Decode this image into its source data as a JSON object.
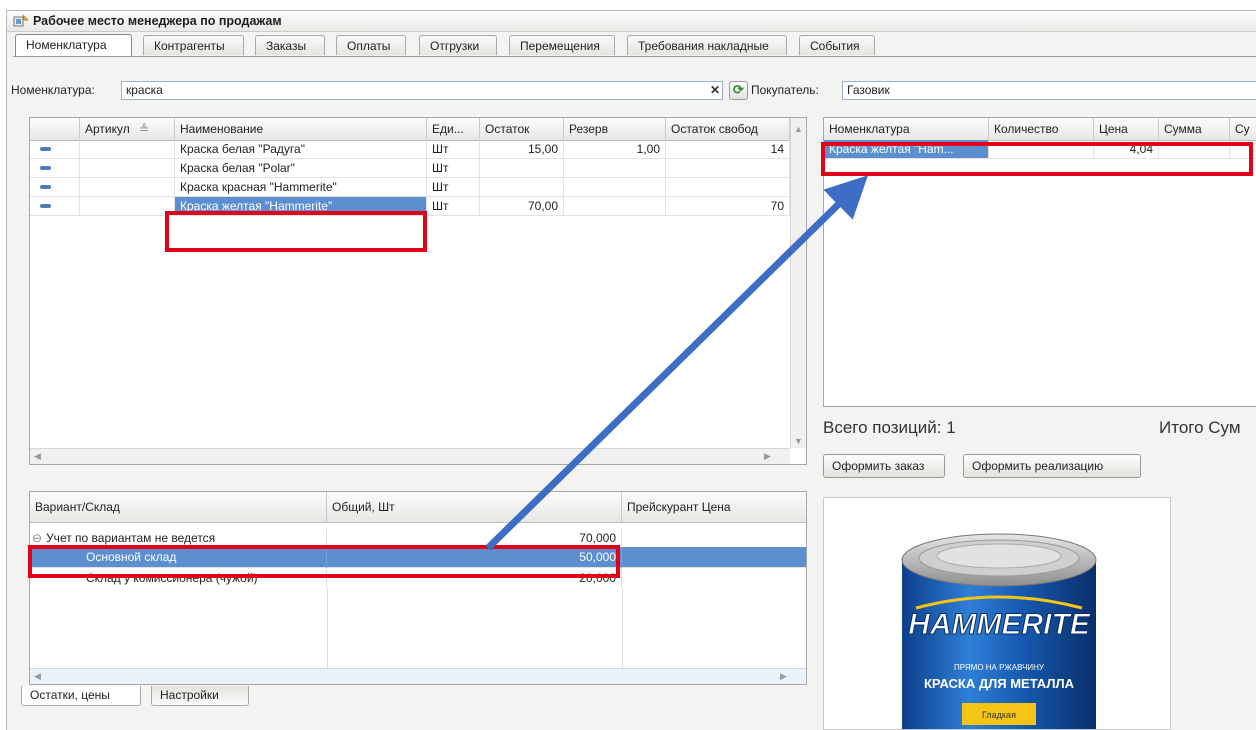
{
  "window": {
    "title": "Рабочее место менеджера по продажам"
  },
  "tabs": [
    "Номенклатура",
    "Контрагенты",
    "Заказы",
    "Оплаты",
    "Отгрузки",
    "Перемещения",
    "Требования накладные",
    "События"
  ],
  "filter": {
    "nomenclature_label": "Номенклатура:",
    "nomenclature_value": "краска",
    "clear_glyph": "✕",
    "refresh_glyph": "⟳",
    "buyer_label": "Покупатель:",
    "buyer_value": "Газовик"
  },
  "products": {
    "columns": [
      "Артикул",
      "Наименование",
      "Еди...",
      "Остаток",
      "Резерв",
      "Остаток свобод"
    ],
    "sort_glyph": "≜",
    "rows": [
      {
        "article": "",
        "name": "Краска белая \"Радуга\"",
        "unit": "Шт",
        "stock": "15,00",
        "reserve": "1,00",
        "free": "14"
      },
      {
        "article": "",
        "name": "Краска белая \"Polar\"",
        "unit": "Шт",
        "stock": "",
        "reserve": "",
        "free": ""
      },
      {
        "article": "",
        "name": "Краска красная \"Hammerite\"",
        "unit": "Шт",
        "stock": "",
        "reserve": "",
        "free": ""
      },
      {
        "article": "",
        "name": "Краска желтая \"Hammerite\"",
        "unit": "Шт",
        "stock": "70,00",
        "reserve": "",
        "free": "70"
      }
    ]
  },
  "order": {
    "columns": [
      "Номенклатура",
      "Количество",
      "Цена",
      "Сумма",
      "Су"
    ],
    "rows": [
      {
        "name": "Краска желтая \"Ham...",
        "qty": "",
        "price": "4,04",
        "sum": "",
        "extra": ""
      }
    ],
    "total_positions": "Всего позиций: 1",
    "total_sum": "Итого Сум",
    "create_order": "Оформить заказ",
    "create_sale": "Оформить реализацию"
  },
  "warehouse": {
    "columns": [
      "Вариант/Склад",
      "Общий, Шт",
      "Прейскурант Цена"
    ],
    "collapse_glyph": "⊖",
    "rows": [
      {
        "name": "Учет по вариантам не ведется",
        "total": "70,000",
        "price": ""
      },
      {
        "name": "Основной склад",
        "total": "50,000",
        "price": ""
      },
      {
        "name": "Склад у комиссионера (чужой)",
        "total": "20,000",
        "price": ""
      }
    ]
  },
  "bottom_tabs": [
    "Остатки, цены",
    "Настройки"
  ],
  "product_image": {
    "brand": "HAMMERITE",
    "line1": "ПРЯМО НА РЖАВЧИНУ",
    "line2": "КРАСКА ДЛЯ МЕТАЛЛА",
    "line3": "Гладкая"
  },
  "colors": {
    "selection": "#5b8fd0",
    "highlight": "#e3001b",
    "arrow": "#3d6dc4"
  }
}
